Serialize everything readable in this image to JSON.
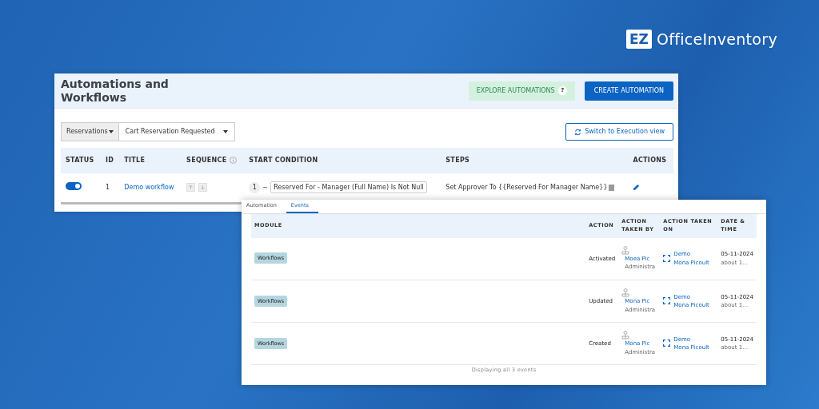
{
  "logo": {
    "mark": "EZ",
    "name": "OfficeInventory"
  },
  "automations": {
    "title": "Automations and Workflows",
    "explore_button": "EXPLORE AUTOMATIONS",
    "explore_help": "?",
    "create_button": "CREATE AUTOMATION",
    "filters": [
      {
        "value": "Reservations"
      },
      {
        "value": "Cart Reservation Requested"
      }
    ],
    "switch_button": "Switch to Execution view",
    "columns": [
      "STATUS",
      "ID",
      "TITLE",
      "SEQUENCE",
      "START CONDITION",
      "STEPS",
      "ACTIONS"
    ],
    "rows": [
      {
        "on": true,
        "id": "1",
        "title": "Demo workflow",
        "condition_index": "1",
        "condition": "Reserved For - Manager (Full Name) Is Not Null",
        "steps": "Set Approver To {{Reserved For Manager Name}}"
      }
    ]
  },
  "events": {
    "tabs": [
      {
        "label": "Automation",
        "selected": false
      },
      {
        "label": "Events",
        "selected": true
      }
    ],
    "columns": [
      "MODULE",
      "ACTION",
      "ACTION TAKEN BY",
      "ACTION TAKEN ON",
      "DATE & TIME"
    ],
    "rows": [
      {
        "module": "Workflows",
        "action": "Activated",
        "user": "Moea Pic",
        "role": "Administra",
        "target": "Demo",
        "target_user": "Mona Picoult",
        "date": "05-11-2024",
        "time": "about 1…"
      },
      {
        "module": "Workflows",
        "action": "Updated",
        "user": "Mona Pic",
        "role": "Administra",
        "target": "Demo",
        "target_user": "Mona Picoult",
        "date": "05-11-2024",
        "time": "about 1…"
      },
      {
        "module": "Workflows",
        "action": "Created",
        "user": "Mona Pic",
        "role": "Administra",
        "target": "Demo",
        "target_user": "Mona Picoult",
        "date": "05-11-2024",
        "time": "about 1…"
      }
    ],
    "footer": "Displaying all 3 events"
  }
}
